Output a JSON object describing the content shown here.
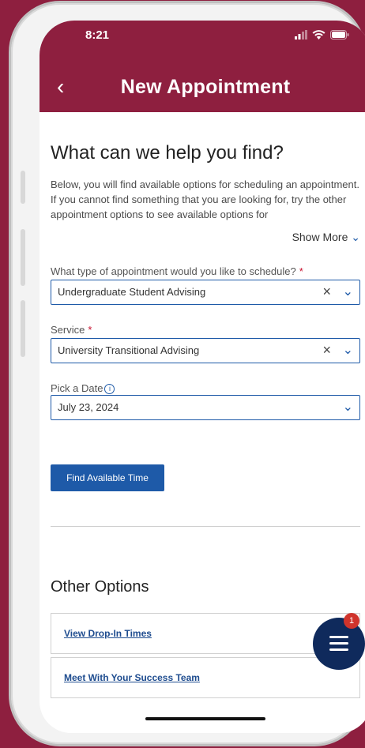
{
  "status": {
    "time": "8:21"
  },
  "nav": {
    "title": "New Appointment"
  },
  "intro": {
    "title": "What can we help you find?",
    "description": "Below, you will find available options for scheduling an appointment. If you cannot find something that you are looking for, try the other appointment options to see available options for",
    "show_more": "Show More"
  },
  "form": {
    "type_label": "What type of appointment would you like to schedule?",
    "type_value": "Undergraduate Student Advising",
    "service_label": "Service",
    "service_value": "University Transitional Advising",
    "date_label": "Pick a Date",
    "date_value": "July 23, 2024",
    "required_mark": "*",
    "find_button": "Find Available Time"
  },
  "other": {
    "title": "Other Options",
    "items": [
      {
        "label": "View Drop-In Times"
      },
      {
        "label": "Meet With Your Success Team"
      }
    ]
  },
  "fab": {
    "badge": "1"
  },
  "colors": {
    "brand": "#8e1f3f",
    "accent": "#1e5aa8",
    "fab": "#0f2a5c",
    "badge": "#d0342c"
  }
}
